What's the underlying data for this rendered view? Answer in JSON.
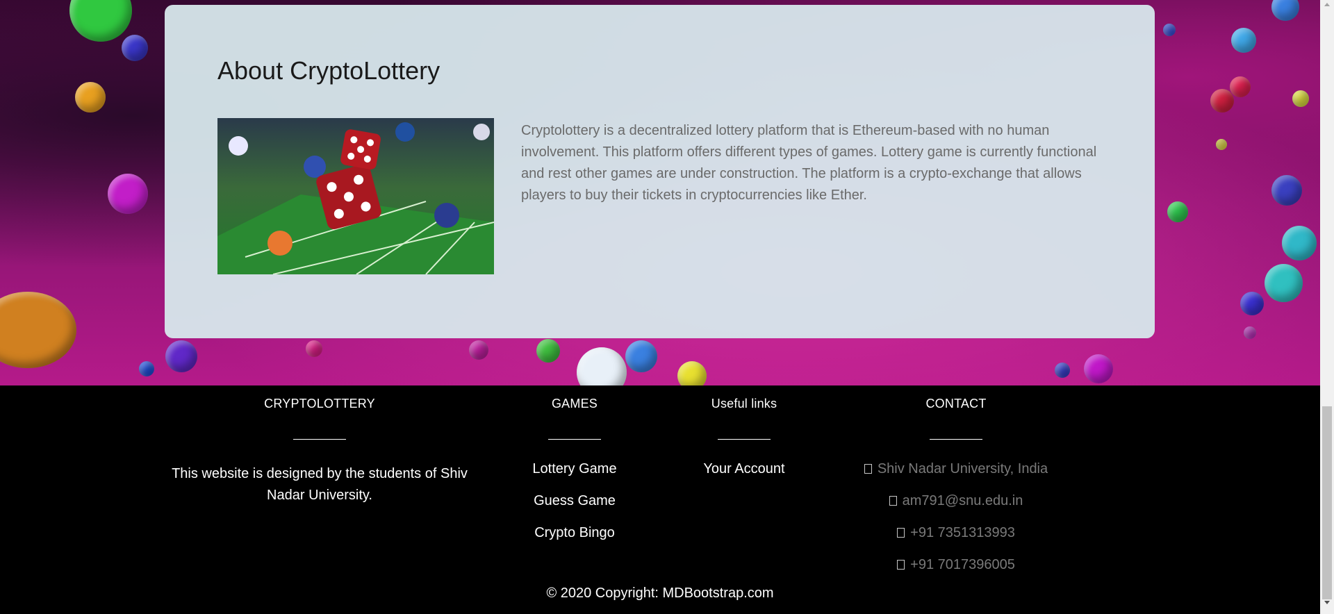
{
  "about": {
    "title": "About CryptoLottery",
    "image_alt": "Dice and casino chips on a craps table",
    "description": "Cryptolottery is a decentralized lottery platform that is Ethereum-based with no human involvement. This platform offers different types of games. Lottery game is currently functional and rest other games are under construction. The platform is a crypto-exchange that allows players to buy their tickets in cryptocurrencies like Ether."
  },
  "footer": {
    "brand": {
      "title": "CRYPTOLOTTERY",
      "text": "This website is designed by the students of Shiv Nadar University."
    },
    "games": {
      "title": "GAMES",
      "links": [
        "Lottery Game",
        "Guess Game",
        "Crypto Bingo"
      ]
    },
    "useful": {
      "title": "Useful links",
      "links": [
        "Your Account"
      ]
    },
    "contact": {
      "title": "CONTACT",
      "items": [
        {
          "icon": "home-icon",
          "text": "Shiv Nadar University, India"
        },
        {
          "icon": "envelope-icon",
          "text": "am791@snu.edu.in"
        },
        {
          "icon": "phone-icon",
          "text": "+91 7351313993"
        },
        {
          "icon": "print-icon",
          "text": "+91 7017396005"
        }
      ]
    },
    "copyright": "© 2020 Copyright: MDBootstrap.com"
  },
  "colors": {
    "card_bg": "#d7e8ec",
    "footer_bg": "#000000",
    "contact_text": "#7a7a7a",
    "body_text": "#6a6a6a"
  }
}
